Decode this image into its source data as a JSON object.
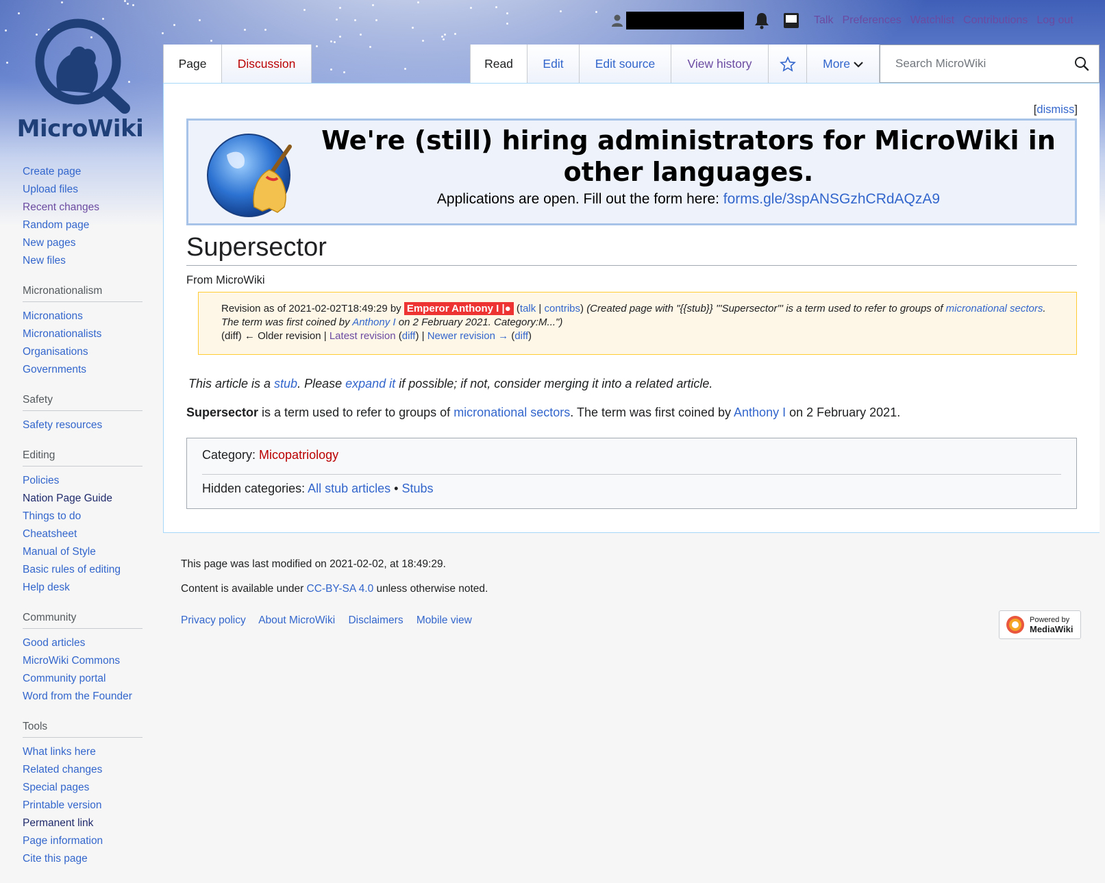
{
  "site": {
    "logo_text": "MicroWiki"
  },
  "personal": {
    "links": [
      "Talk",
      "Preferences",
      "Watchlist",
      "Contributions",
      "Log out"
    ]
  },
  "tabs": {
    "page": "Page",
    "discussion": "Discussion",
    "read": "Read",
    "edit": "Edit",
    "edit_source": "Edit source",
    "view_history": "View history",
    "more": "More"
  },
  "search": {
    "placeholder": "Search MicroWiki"
  },
  "sidebar": {
    "navigation": [
      "Create page",
      "Upload files",
      "Recent changes",
      "Random page",
      "New pages",
      "New files"
    ],
    "portals": [
      {
        "title": "Micronationalism",
        "items": [
          "Micronations",
          "Micronationalists",
          "Organisations",
          "Governments"
        ]
      },
      {
        "title": "Safety",
        "items": [
          "Safety resources"
        ]
      },
      {
        "title": "Editing",
        "items": [
          "Policies",
          "Nation Page Guide",
          "Things to do",
          "Cheatsheet",
          "Manual of Style",
          "Basic rules of editing",
          "Help desk"
        ]
      },
      {
        "title": "Community",
        "items": [
          "Good articles",
          "MicroWiki Commons",
          "Community portal",
          "Word from the Founder"
        ]
      },
      {
        "title": "Tools",
        "items": [
          "What links here",
          "Related changes",
          "Special pages",
          "Printable version",
          "Permanent link",
          "Page information",
          "Cite this page"
        ]
      }
    ]
  },
  "notice": {
    "dismiss": "dismiss",
    "title": "We're (still) hiring administrators for MicroWiki in other languages.",
    "subtitle_prefix": "Applications are open. Fill out the form here: ",
    "form_link": "forms.gle/3spANSGzhCRdAQzA9"
  },
  "article": {
    "title": "Supersector",
    "tagline": "From MicroWiki",
    "revision": {
      "prefix": "Revision as of 2021-02-02T18:49:29 by ",
      "user": "Emperor Anthony I",
      "talk": "talk",
      "contribs": "contribs",
      "summary_1": "(Created page with \"{{stub}} '''Supersector''' is a term used to refer to groups of ",
      "summary_link": "micronational sectors",
      "summary_2": ". The term was first coined by ",
      "summary_link2": "Anthony I",
      "summary_3": " on 2 February 2021. Category:M...\")",
      "diff1": "(diff)",
      "older": "← Older revision",
      "latest": "Latest revision",
      "diff2": "diff",
      "newer": "Newer revision →",
      "diff3": "diff"
    },
    "stub": {
      "t1": "This article is a ",
      "link1": "stub",
      "t2": ". Please ",
      "link2": "expand it",
      "t3": " if possible; if not, consider merging it into a related article."
    },
    "lead": {
      "bold": "Supersector",
      "t1": " is a term used to refer to groups of ",
      "link1": "micronational sectors",
      "t2": ". The term was first coined by ",
      "link2": "Anthony I",
      "t3": " on 2 February 2021."
    },
    "categories": {
      "label": "Category: ",
      "items": [
        "Micopatriology"
      ],
      "hidden_label": "Hidden categories: ",
      "hidden_items": [
        "All stub articles",
        "Stubs"
      ]
    }
  },
  "footer": {
    "last_modified": "This page was last modified on 2021-02-02, at 18:49:29.",
    "license_prefix": "Content is available under ",
    "license_link": "CC-BY-SA 4.0",
    "license_suffix": " unless otherwise noted.",
    "places": [
      "Privacy policy",
      "About MicroWiki",
      "Disclaimers",
      "Mobile view"
    ],
    "powered_by": "Powered by",
    "powered_brand": "MediaWiki"
  }
}
